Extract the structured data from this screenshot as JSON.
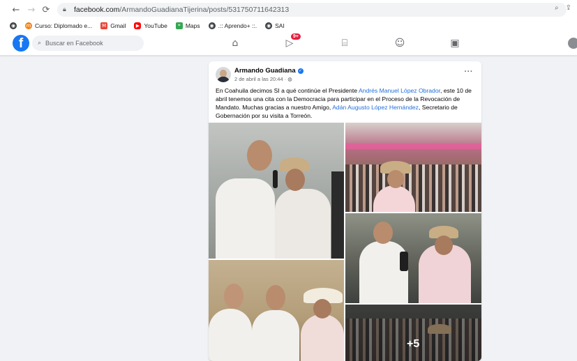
{
  "browser": {
    "url_host": "facebook.com",
    "url_path": "/ArmandoGuadianaTijerina/posts/531750711642313",
    "bookmarks": [
      {
        "label": "Curso: Diplomado e...",
        "icon": "moodle-icon",
        "color": "#f98012"
      },
      {
        "label": "Gmail",
        "icon": "gmail-icon",
        "color": "#ea4335"
      },
      {
        "label": "YouTube",
        "icon": "youtube-icon",
        "color": "#ff0000"
      },
      {
        "label": "Maps",
        "icon": "maps-icon",
        "color": "#34a853"
      },
      {
        "label": ".:: Aprendo+ ::.",
        "icon": "globe-icon",
        "color": "#3c4043"
      },
      {
        "label": "SAI",
        "icon": "globe-icon",
        "color": "#3c4043"
      }
    ]
  },
  "facebook": {
    "logo": "f",
    "search_placeholder": "Buscar en Facebook",
    "nav_icons": [
      "home-icon",
      "watch-icon",
      "marketplace-icon",
      "groups-icon",
      "gaming-icon"
    ],
    "watch_badge": "9+",
    "brand_color": "#1877f2"
  },
  "post": {
    "author": "Armando Guadiana",
    "time": "2 de abril a las 20:44 · ",
    "text_1": "En Coahuila decimos SI a qué continúe el Presidente ",
    "mention_1": "Andrés Manuel López Obrador",
    "text_2": ", este 10 de abril tenemos una cita con la Democracia para participar en el Proceso de la Revocación de Mandato. Muchas gracias a nuestro Amigo, ",
    "mention_2": "Adán Augusto López Hernández",
    "text_3": ", Secretario de Gobernación por su visita a Torreón.",
    "more_photos": "+5"
  }
}
